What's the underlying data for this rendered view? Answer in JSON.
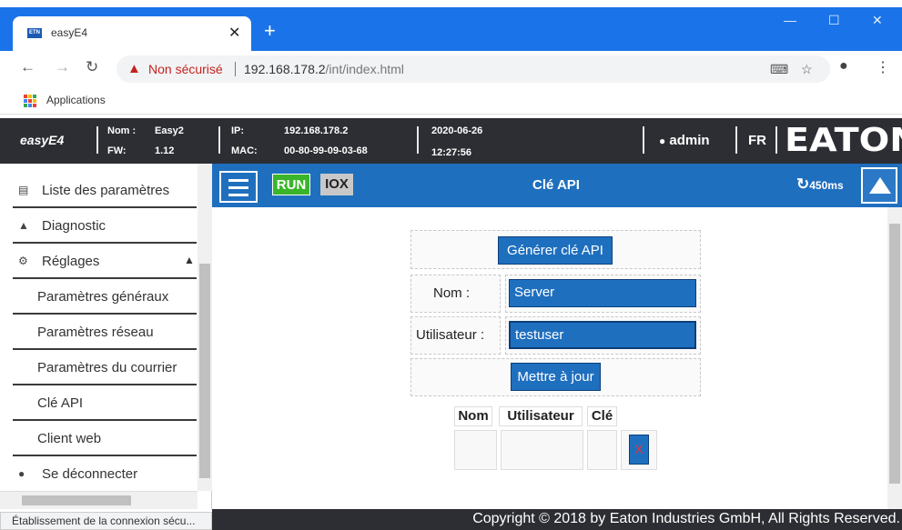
{
  "browser": {
    "tab_title": "easyE4",
    "favicon_text": "ETN",
    "security_warning": "Non sécurisé",
    "url_host": "192.168.178.2",
    "url_path": "/int/index.html",
    "bookmarks_apps": "Applications",
    "status_text": "Établissement de la connexion sécu..."
  },
  "device": {
    "brand": "easyE4",
    "name_label": "Nom :",
    "name_value": "Easy2",
    "fw_label": "FW:",
    "fw_value": "1.12",
    "ip_label": "IP:",
    "ip_value": "192.168.178.2",
    "mac_label": "MAC:",
    "mac_value": "00-80-99-09-03-68",
    "date": "2020-06-26",
    "time": "12:27:56",
    "user": "admin",
    "language": "FR",
    "logo": "EATON"
  },
  "sidebar": {
    "items": [
      {
        "label": "Liste des paramètres",
        "icon": "list-icon"
      },
      {
        "label": "Diagnostic",
        "icon": "warning-icon"
      },
      {
        "label": "Réglages",
        "icon": "gear-icon"
      },
      {
        "label": "Paramètres généraux"
      },
      {
        "label": "Paramètres réseau"
      },
      {
        "label": "Paramètres du courrier"
      },
      {
        "label": "Clé API"
      },
      {
        "label": "Client web"
      },
      {
        "label": "Se déconnecter",
        "icon": "user-icon"
      }
    ]
  },
  "toolbar": {
    "run_label": "RUN",
    "iox_label": "IOX",
    "title": "Clé API",
    "cycle_time": "450ms"
  },
  "api_key_form": {
    "generate_label": "Générer clé API",
    "name_label": "Nom  :",
    "name_value": "Server",
    "user_label": "Utilisateur  :",
    "user_value": "testuser",
    "update_label": "Mettre à jour",
    "table_headers": [
      "Nom",
      "Utilisateur",
      "Clé"
    ],
    "delete_label": "X"
  },
  "footer": {
    "copyright": "Copyright © 2018 by Eaton Industries GmbH, All Rights Reserved."
  },
  "colors": {
    "chrome_blue": "#1a73e8",
    "header_dark": "#2c2e33",
    "toolbar_blue": "#1f6fbf",
    "run_green": "#3ab52a",
    "warning_red": "#c5221f"
  }
}
